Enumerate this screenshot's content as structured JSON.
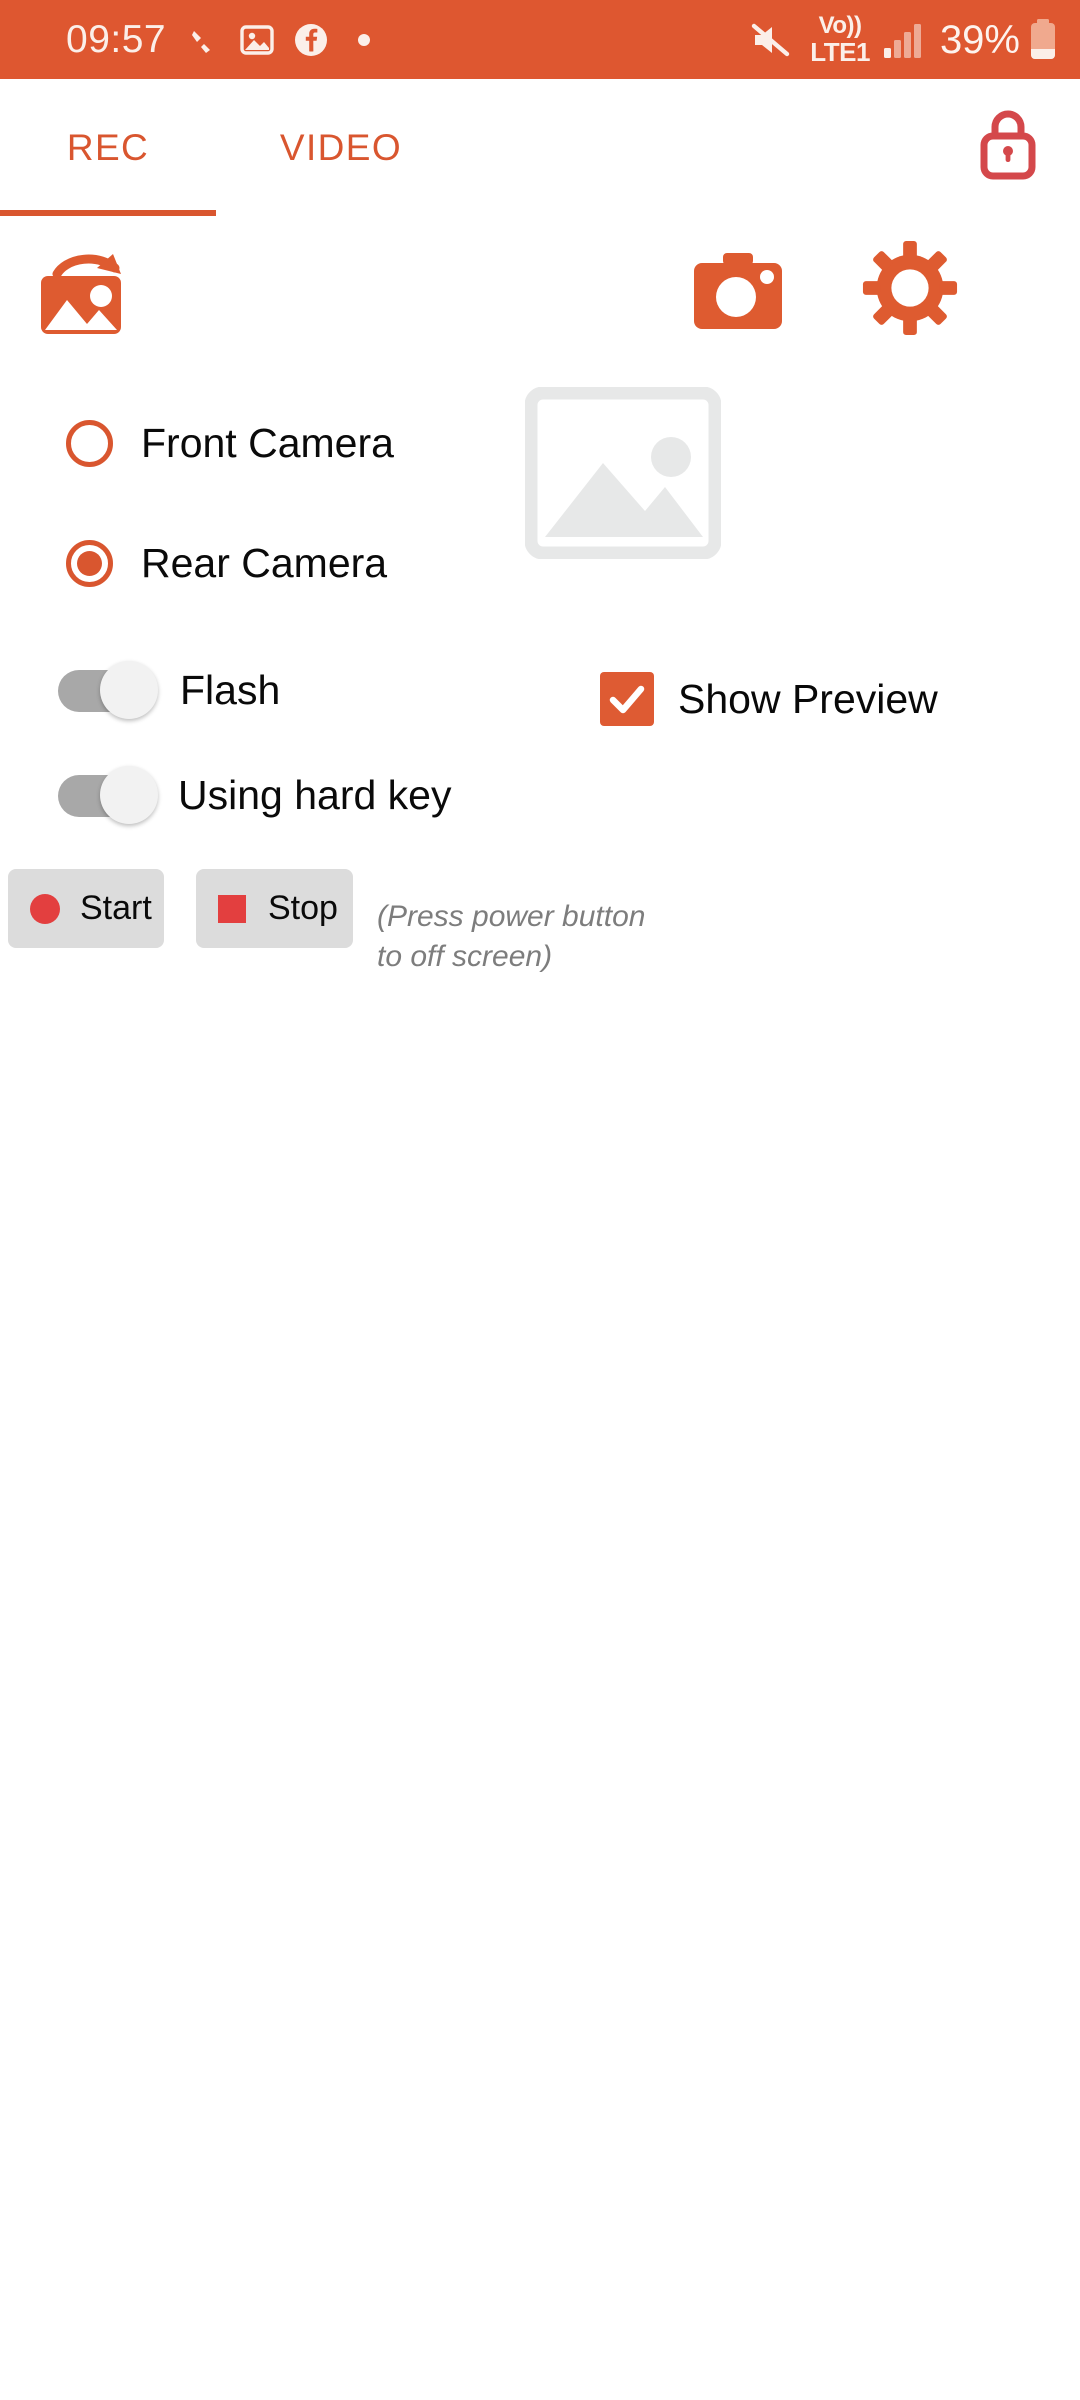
{
  "status_bar": {
    "background_color": "#DE5730",
    "clock": "09:57",
    "left_icons": [
      {
        "name": "pen-mark-icon",
        "label": "pen"
      },
      {
        "name": "photo-icon",
        "label": "photo"
      },
      {
        "name": "facebook-icon",
        "label": "facebook"
      },
      {
        "name": "dot-icon",
        "label": "dot"
      }
    ],
    "right_icons": [
      {
        "name": "mute-icon",
        "label": "mute"
      },
      {
        "name": "volte-icon",
        "label": "Vo))"
      },
      {
        "name": "network-type",
        "label": "LTE1"
      },
      {
        "name": "signal-bars-icon",
        "label": "signal"
      }
    ],
    "battery_percent": "39%",
    "battery_icon": "battery-icon"
  },
  "tabs": {
    "items": [
      {
        "id": "rec",
        "label": "REC",
        "active": true
      },
      {
        "id": "video",
        "label": "VIDEO",
        "active": false
      }
    ],
    "accent_color": "#D9562F",
    "lock_icon": "lock-icon",
    "lock_color": "#D4484B"
  },
  "toolbar": {
    "gallery_rotate_icon": "gallery-rotate-icon",
    "camera_icon": "camera-icon",
    "settings_icon": "gear-icon",
    "icon_color": "#DE5B30"
  },
  "camera_selection": {
    "options": [
      {
        "id": "front",
        "label": "Front Camera",
        "selected": false
      },
      {
        "id": "rear",
        "label": "Rear Camera",
        "selected": true
      }
    ]
  },
  "preview_thumbnail": {
    "icon": "image-placeholder-icon",
    "color": "#E7E8E8"
  },
  "switches": [
    {
      "id": "flash",
      "label": "Flash",
      "on": false
    },
    {
      "id": "hard_key",
      "label": "Using hard key",
      "on": false
    }
  ],
  "checkbox": {
    "id": "show_preview",
    "label": "Show Preview",
    "checked": true,
    "color": "#DE5B33"
  },
  "actions": {
    "start_label": "Start",
    "stop_label": "Stop",
    "glyph_color": "#E33F3F",
    "hint": "(Press power button to off screen)"
  }
}
